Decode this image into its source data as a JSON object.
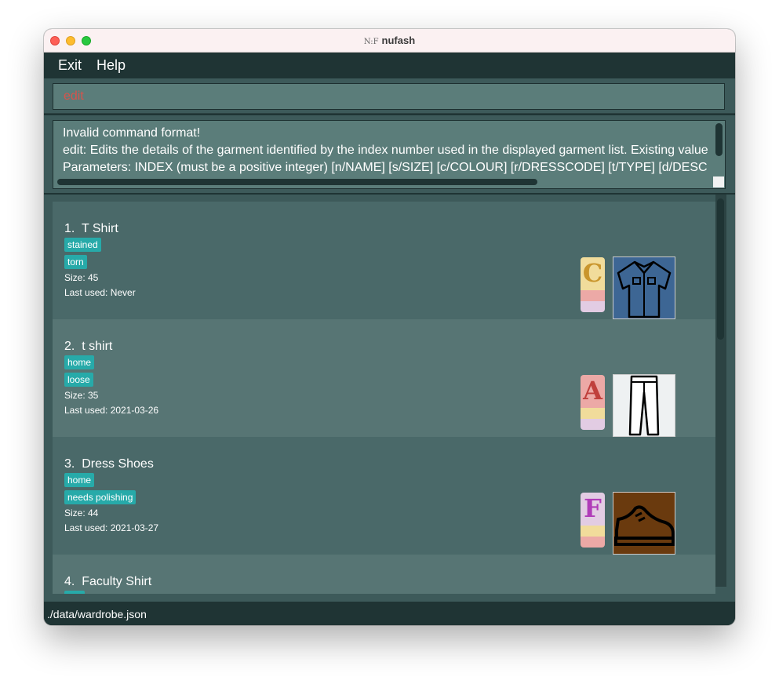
{
  "window": {
    "title": "nufash",
    "logo_text": "N:F"
  },
  "menu": {
    "items": [
      "Exit",
      "Help"
    ]
  },
  "command_box": {
    "value": "edit"
  },
  "result_display": {
    "lines": [
      "Invalid command format!",
      "edit: Edits the details of the garment identified by the index number used in the displayed garment list. Existing value",
      "Parameters: INDEX (must be a positive integer) [n/NAME] [s/SIZE] [c/COLOUR] [r/DRESSCODE] [t/TYPE] [d/DESC"
    ]
  },
  "garments": [
    {
      "index": "1.",
      "name": "T Shirt",
      "tags": [
        "stained",
        "torn"
      ],
      "size": "Size: 45",
      "last_used": "Last used: Never",
      "letter": "C",
      "icon": "shirt-icon",
      "colors": [
        "#f1dc9b",
        "#eca9a6",
        "#e2cce3"
      ],
      "letter_color": "#c9952c"
    },
    {
      "index": "2.",
      "name": "t shirt",
      "tags": [
        "home",
        "loose"
      ],
      "size": "Size: 35",
      "last_used": "Last used: 2021-03-26",
      "letter": "A",
      "icon": "pants-icon",
      "colors": [
        "#eca9a6",
        "#f1dc9b",
        "#e2cce3"
      ],
      "letter_color": "#c0403c"
    },
    {
      "index": "3.",
      "name": "Dress Shoes",
      "tags": [
        "home",
        "needs polishing"
      ],
      "size": "Size: 44",
      "last_used": "Last used: 2021-03-27",
      "letter": "F",
      "icon": "shoe-icon",
      "colors": [
        "#e2cce3",
        "#f1dc9b",
        "#eca9a6"
      ],
      "letter_color": "#b03cb8"
    },
    {
      "index": "4.",
      "name": "Faculty Shirt",
      "tags": [
        ""
      ],
      "size": "",
      "last_used": ""
    }
  ],
  "status_bar": {
    "path": "./data/wardrobe.json"
  }
}
